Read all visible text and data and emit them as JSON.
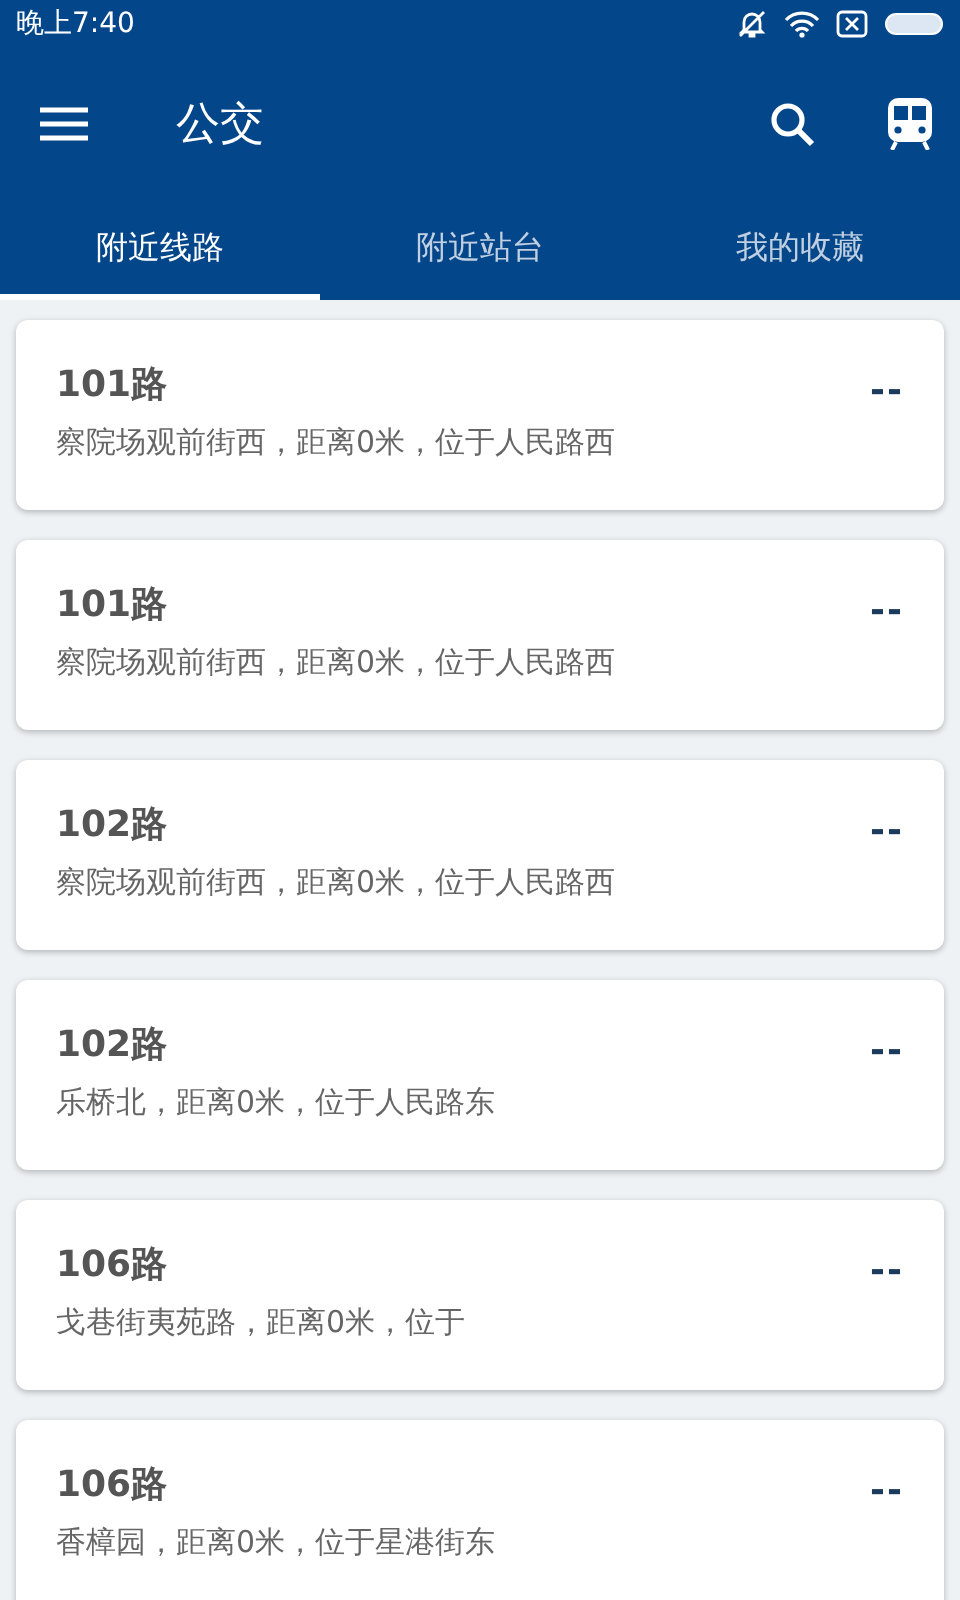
{
  "status_bar": {
    "time": "晚上7:40"
  },
  "toolbar": {
    "title": "公交"
  },
  "tabs": [
    {
      "label": "附近线路",
      "selected": true
    },
    {
      "label": "附近站台",
      "selected": false
    },
    {
      "label": "我的收藏",
      "selected": false
    }
  ],
  "routes": [
    {
      "name": "101路",
      "detail": "察院场观前街西，距离0米，位于人民路西",
      "eta": "--"
    },
    {
      "name": "101路",
      "detail": "察院场观前街西，距离0米，位于人民路西",
      "eta": "--"
    },
    {
      "name": "102路",
      "detail": "察院场观前街西，距离0米，位于人民路西",
      "eta": "--"
    },
    {
      "name": "102路",
      "detail": "乐桥北，距离0米，位于人民路东",
      "eta": "--"
    },
    {
      "name": "106路",
      "detail": "戈巷街夷苑路，距离0米，位于",
      "eta": "--"
    },
    {
      "name": "106路",
      "detail": "香樟园，距离0米，位于星港街东",
      "eta": "--"
    }
  ]
}
